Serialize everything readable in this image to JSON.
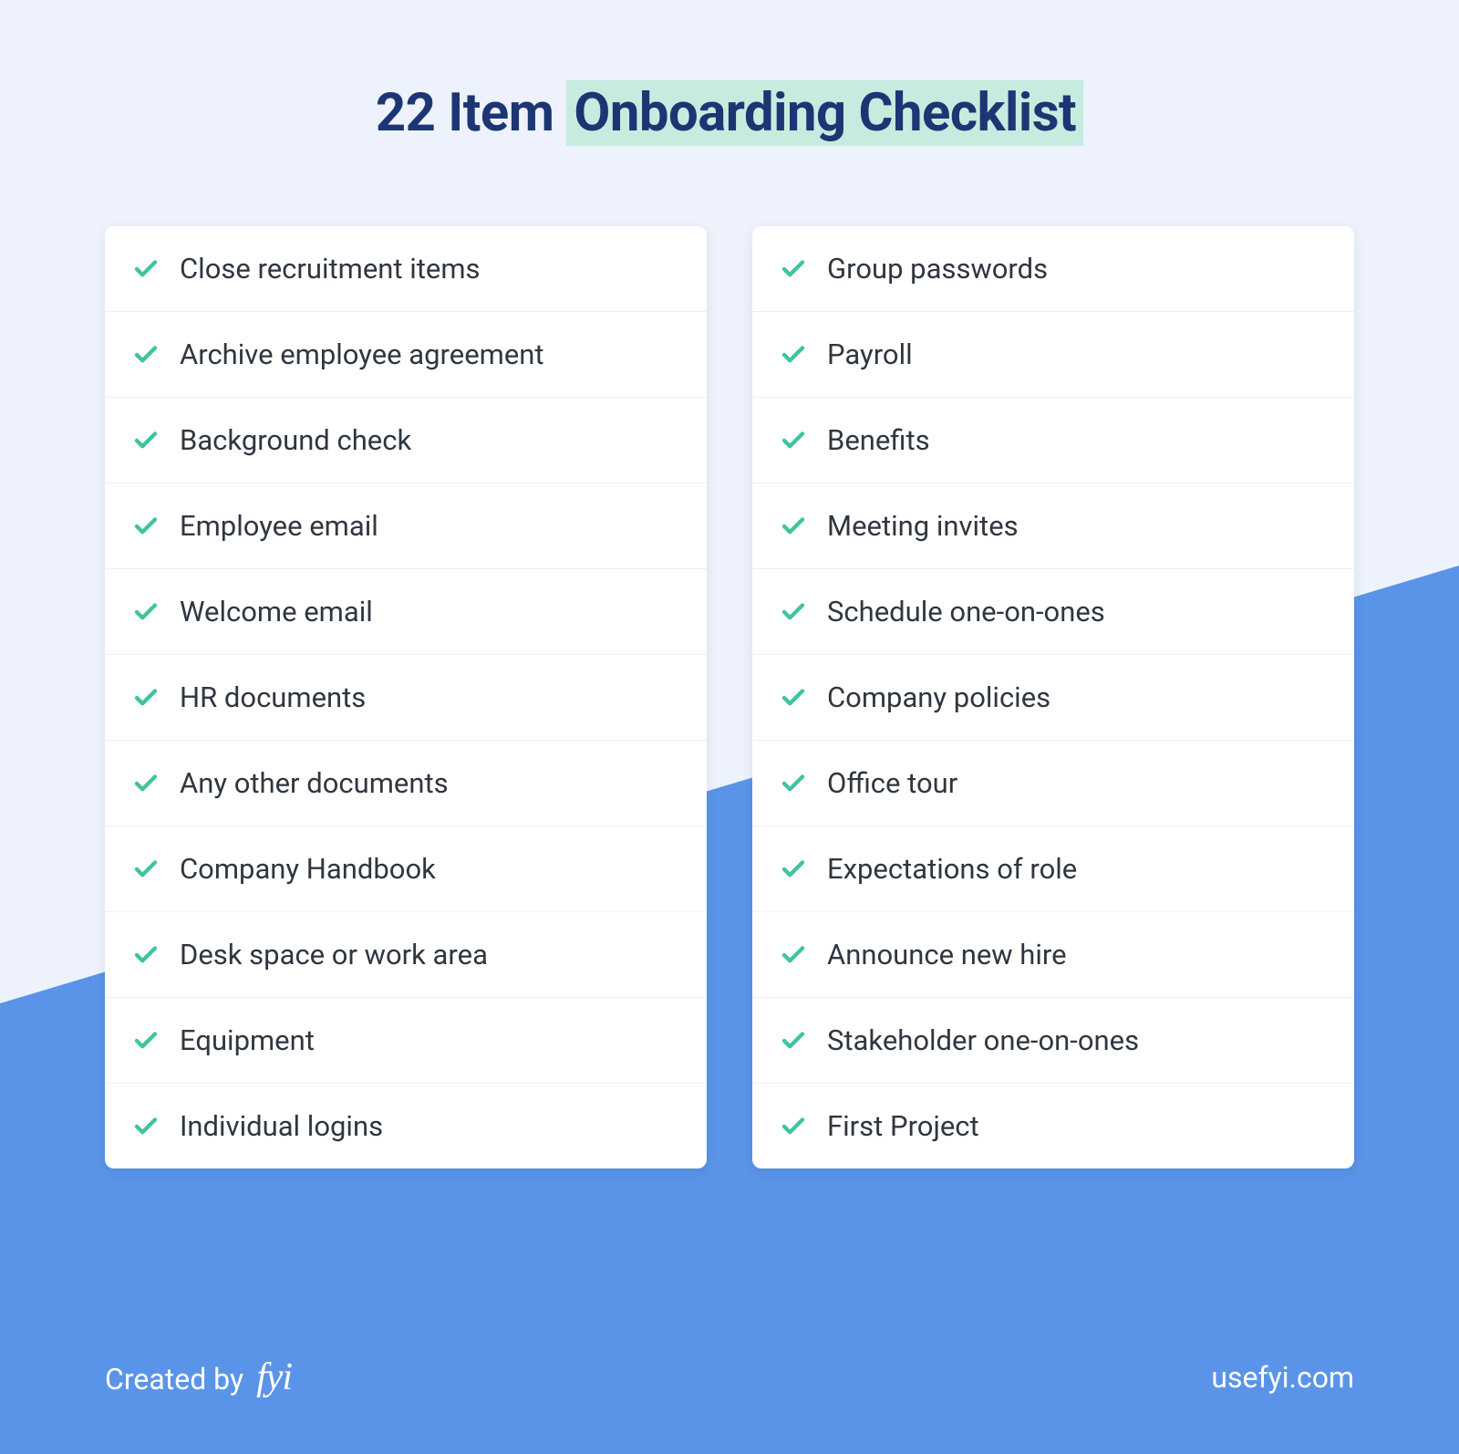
{
  "title_prefix": "22 Item ",
  "title_highlight": "Onboarding Checklist",
  "columns": [
    {
      "items": [
        "Close recruitment items",
        "Archive employee agreement",
        "Background check",
        "Employee email",
        "Welcome email",
        "HR documents",
        "Any other documents",
        "Company Handbook",
        "Desk space or work area",
        "Equipment",
        "Individual logins"
      ]
    },
    {
      "items": [
        "Group passwords",
        "Payroll",
        "Benefits",
        "Meeting invites",
        "Schedule one-on-ones",
        "Company policies",
        "Office tour",
        "Expectations of role",
        "Announce new hire",
        "Stakeholder one-on-ones",
        "First Project"
      ]
    }
  ],
  "footer": {
    "created_by": "Created by",
    "logo_text": "fyi",
    "url": "usefyi.com"
  }
}
